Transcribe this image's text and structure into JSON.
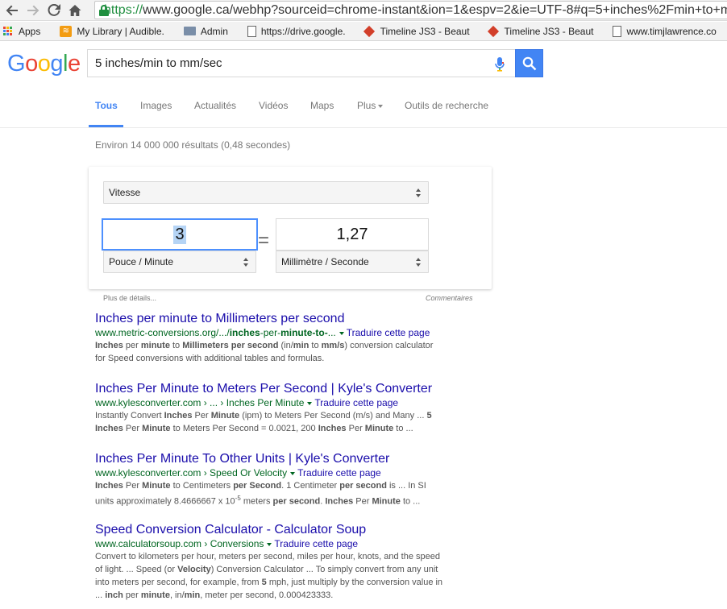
{
  "browser": {
    "url_https": "https://",
    "url_rest": "www.google.ca/webhp?sourceid=chrome-instant&ion=1&espv=2&ie=UTF-8#q=5+inches%2Fmin+to+mm%2F"
  },
  "bookmarks": [
    {
      "label": "Apps",
      "icon": "apps-grid-icon"
    },
    {
      "label": "My Library | Audible.",
      "icon": "audible-icon"
    },
    {
      "label": "Admin",
      "icon": "folder-icon"
    },
    {
      "label": "https://drive.google.",
      "icon": "document-icon"
    },
    {
      "label": "Timeline JS3 - Beaut",
      "icon": "timeline-icon"
    },
    {
      "label": "Timeline JS3 - Beaut",
      "icon": "timeline-icon"
    },
    {
      "label": "www.timjlawrence.co",
      "icon": "document-icon"
    }
  ],
  "search": {
    "logo": "Google",
    "query": "5 inches/min to mm/sec"
  },
  "tabs": [
    "Tous",
    "Images",
    "Actualités",
    "Vidéos",
    "Maps",
    "Plus",
    "Outils de recherche"
  ],
  "result_stats": "Environ 14 000 000 résultats (0,48 secondes)",
  "converter": {
    "quantity": "Vitesse",
    "from_value": "3",
    "from_unit": "Pouce / Minute",
    "equals": "=",
    "to_value": "1,27",
    "to_unit": "Millimètre / Seconde",
    "more_details": "Plus de détails...",
    "feedback": "Commentaires"
  },
  "results": [
    {
      "title": "Inches per minute to Millimeters per second",
      "url_prefix": "www.metric-conversions.org/.../",
      "url_bold": "inches",
      "url_mid": "-per-",
      "url_bold2": "minute-to-",
      "url_suffix": "...",
      "translate": "Traduire cette page",
      "snippet": [
        [
          {
            "b": "Inches"
          },
          {
            "t": " per "
          },
          {
            "b": "minute"
          },
          {
            "t": " to "
          },
          {
            "b": "Millimeters per second"
          },
          {
            "t": " (in/"
          },
          {
            "b": "min"
          },
          {
            "t": " to "
          },
          {
            "b": "mm/s"
          },
          {
            "t": ") conversion calculator"
          }
        ],
        [
          {
            "t": "for Speed conversions with additional tables and formulas."
          }
        ]
      ]
    },
    {
      "title": "Inches Per Minute to Meters Per Second | Kyle's Converter",
      "url_prefix": "www.kylesconverter.com › ... › Inches Per Minute",
      "translate": "Traduire cette page",
      "snippet": [
        [
          {
            "t": "Instantly Convert "
          },
          {
            "b": "Inches"
          },
          {
            "t": " Per "
          },
          {
            "b": "Minute"
          },
          {
            "t": " (ipm) to Meters Per Second (m/s) and Many ... "
          },
          {
            "b": "5"
          }
        ],
        [
          {
            "b": "Inches"
          },
          {
            "t": " Per "
          },
          {
            "b": "Minute"
          },
          {
            "t": " to Meters Per Second = 0.0021, 200 "
          },
          {
            "b": "Inches"
          },
          {
            "t": " Per "
          },
          {
            "b": "Minute"
          },
          {
            "t": " to  ..."
          }
        ]
      ]
    },
    {
      "title": "Inches Per Minute To Other Units | Kyle's Converter",
      "url_prefix": "www.kylesconverter.com › Speed Or Velocity",
      "translate": "Traduire cette page",
      "snippet": [
        [
          {
            "b": "Inches"
          },
          {
            "t": " Per "
          },
          {
            "b": "Minute"
          },
          {
            "t": " to Centimeters "
          },
          {
            "b": "per Second"
          },
          {
            "t": ". 1 Centimeter "
          },
          {
            "b": "per second"
          },
          {
            "t": " is ... In SI"
          }
        ],
        [
          {
            "t": "units approximately 8.4666667 x 10"
          },
          {
            "sup": "-5"
          },
          {
            "t": " meters "
          },
          {
            "b": "per second"
          },
          {
            "t": ". "
          },
          {
            "b": "Inches"
          },
          {
            "t": " Per "
          },
          {
            "b": "Minute"
          },
          {
            "t": " to  ..."
          }
        ]
      ]
    },
    {
      "title": "Speed Conversion Calculator - Calculator Soup",
      "url_prefix": "www.calculatorsoup.com › Conversions",
      "translate": "Traduire cette page",
      "snippet": [
        [
          {
            "t": "Convert to kilometers per hour, meters per second, miles per hour, knots, and the speed"
          }
        ],
        [
          {
            "t": "of light. ... Speed (or "
          },
          {
            "b": "Velocity"
          },
          {
            "t": ") Conversion Calculator ... To simply convert from any unit"
          }
        ],
        [
          {
            "t": "into meters per second, for example, from "
          },
          {
            "b": "5"
          },
          {
            "t": " mph, just multiply by the conversion value in"
          }
        ],
        [
          {
            "t": "... "
          },
          {
            "b": "inch"
          },
          {
            "t": " per "
          },
          {
            "b": "minute"
          },
          {
            "t": ", in/"
          },
          {
            "b": "min"
          },
          {
            "t": ", meter per second, 0.000423333."
          }
        ]
      ]
    }
  ]
}
